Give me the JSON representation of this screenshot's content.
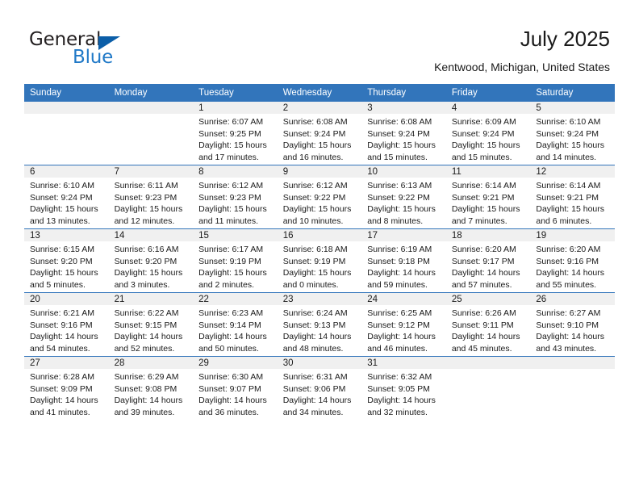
{
  "brand": {
    "name_dark": "General",
    "name_light": "Blue",
    "triangle_icon": "triangle-icon",
    "accent_color": "#2079c7",
    "dark_color": "#231f20"
  },
  "header": {
    "title": "July 2025",
    "subtitle": "Kentwood, Michigan, United States"
  },
  "calendar": {
    "header_bg": "#3275bb",
    "daynum_bg": "#f0f0f0",
    "weekday_headers": [
      "Sunday",
      "Monday",
      "Tuesday",
      "Wednesday",
      "Thursday",
      "Friday",
      "Saturday"
    ],
    "weeks": [
      [
        {
          "day": ""
        },
        {
          "day": ""
        },
        {
          "day": "1",
          "sunrise": "Sunrise: 6:07 AM",
          "sunset": "Sunset: 9:25 PM",
          "daylight": "Daylight: 15 hours and 17 minutes."
        },
        {
          "day": "2",
          "sunrise": "Sunrise: 6:08 AM",
          "sunset": "Sunset: 9:24 PM",
          "daylight": "Daylight: 15 hours and 16 minutes."
        },
        {
          "day": "3",
          "sunrise": "Sunrise: 6:08 AM",
          "sunset": "Sunset: 9:24 PM",
          "daylight": "Daylight: 15 hours and 15 minutes."
        },
        {
          "day": "4",
          "sunrise": "Sunrise: 6:09 AM",
          "sunset": "Sunset: 9:24 PM",
          "daylight": "Daylight: 15 hours and 15 minutes."
        },
        {
          "day": "5",
          "sunrise": "Sunrise: 6:10 AM",
          "sunset": "Sunset: 9:24 PM",
          "daylight": "Daylight: 15 hours and 14 minutes."
        }
      ],
      [
        {
          "day": "6",
          "sunrise": "Sunrise: 6:10 AM",
          "sunset": "Sunset: 9:24 PM",
          "daylight": "Daylight: 15 hours and 13 minutes."
        },
        {
          "day": "7",
          "sunrise": "Sunrise: 6:11 AM",
          "sunset": "Sunset: 9:23 PM",
          "daylight": "Daylight: 15 hours and 12 minutes."
        },
        {
          "day": "8",
          "sunrise": "Sunrise: 6:12 AM",
          "sunset": "Sunset: 9:23 PM",
          "daylight": "Daylight: 15 hours and 11 minutes."
        },
        {
          "day": "9",
          "sunrise": "Sunrise: 6:12 AM",
          "sunset": "Sunset: 9:22 PM",
          "daylight": "Daylight: 15 hours and 10 minutes."
        },
        {
          "day": "10",
          "sunrise": "Sunrise: 6:13 AM",
          "sunset": "Sunset: 9:22 PM",
          "daylight": "Daylight: 15 hours and 8 minutes."
        },
        {
          "day": "11",
          "sunrise": "Sunrise: 6:14 AM",
          "sunset": "Sunset: 9:21 PM",
          "daylight": "Daylight: 15 hours and 7 minutes."
        },
        {
          "day": "12",
          "sunrise": "Sunrise: 6:14 AM",
          "sunset": "Sunset: 9:21 PM",
          "daylight": "Daylight: 15 hours and 6 minutes."
        }
      ],
      [
        {
          "day": "13",
          "sunrise": "Sunrise: 6:15 AM",
          "sunset": "Sunset: 9:20 PM",
          "daylight": "Daylight: 15 hours and 5 minutes."
        },
        {
          "day": "14",
          "sunrise": "Sunrise: 6:16 AM",
          "sunset": "Sunset: 9:20 PM",
          "daylight": "Daylight: 15 hours and 3 minutes."
        },
        {
          "day": "15",
          "sunrise": "Sunrise: 6:17 AM",
          "sunset": "Sunset: 9:19 PM",
          "daylight": "Daylight: 15 hours and 2 minutes."
        },
        {
          "day": "16",
          "sunrise": "Sunrise: 6:18 AM",
          "sunset": "Sunset: 9:19 PM",
          "daylight": "Daylight: 15 hours and 0 minutes."
        },
        {
          "day": "17",
          "sunrise": "Sunrise: 6:19 AM",
          "sunset": "Sunset: 9:18 PM",
          "daylight": "Daylight: 14 hours and 59 minutes."
        },
        {
          "day": "18",
          "sunrise": "Sunrise: 6:20 AM",
          "sunset": "Sunset: 9:17 PM",
          "daylight": "Daylight: 14 hours and 57 minutes."
        },
        {
          "day": "19",
          "sunrise": "Sunrise: 6:20 AM",
          "sunset": "Sunset: 9:16 PM",
          "daylight": "Daylight: 14 hours and 55 minutes."
        }
      ],
      [
        {
          "day": "20",
          "sunrise": "Sunrise: 6:21 AM",
          "sunset": "Sunset: 9:16 PM",
          "daylight": "Daylight: 14 hours and 54 minutes."
        },
        {
          "day": "21",
          "sunrise": "Sunrise: 6:22 AM",
          "sunset": "Sunset: 9:15 PM",
          "daylight": "Daylight: 14 hours and 52 minutes."
        },
        {
          "day": "22",
          "sunrise": "Sunrise: 6:23 AM",
          "sunset": "Sunset: 9:14 PM",
          "daylight": "Daylight: 14 hours and 50 minutes."
        },
        {
          "day": "23",
          "sunrise": "Sunrise: 6:24 AM",
          "sunset": "Sunset: 9:13 PM",
          "daylight": "Daylight: 14 hours and 48 minutes."
        },
        {
          "day": "24",
          "sunrise": "Sunrise: 6:25 AM",
          "sunset": "Sunset: 9:12 PM",
          "daylight": "Daylight: 14 hours and 46 minutes."
        },
        {
          "day": "25",
          "sunrise": "Sunrise: 6:26 AM",
          "sunset": "Sunset: 9:11 PM",
          "daylight": "Daylight: 14 hours and 45 minutes."
        },
        {
          "day": "26",
          "sunrise": "Sunrise: 6:27 AM",
          "sunset": "Sunset: 9:10 PM",
          "daylight": "Daylight: 14 hours and 43 minutes."
        }
      ],
      [
        {
          "day": "27",
          "sunrise": "Sunrise: 6:28 AM",
          "sunset": "Sunset: 9:09 PM",
          "daylight": "Daylight: 14 hours and 41 minutes."
        },
        {
          "day": "28",
          "sunrise": "Sunrise: 6:29 AM",
          "sunset": "Sunset: 9:08 PM",
          "daylight": "Daylight: 14 hours and 39 minutes."
        },
        {
          "day": "29",
          "sunrise": "Sunrise: 6:30 AM",
          "sunset": "Sunset: 9:07 PM",
          "daylight": "Daylight: 14 hours and 36 minutes."
        },
        {
          "day": "30",
          "sunrise": "Sunrise: 6:31 AM",
          "sunset": "Sunset: 9:06 PM",
          "daylight": "Daylight: 14 hours and 34 minutes."
        },
        {
          "day": "31",
          "sunrise": "Sunrise: 6:32 AM",
          "sunset": "Sunset: 9:05 PM",
          "daylight": "Daylight: 14 hours and 32 minutes."
        },
        {
          "day": ""
        },
        {
          "day": ""
        }
      ]
    ]
  }
}
